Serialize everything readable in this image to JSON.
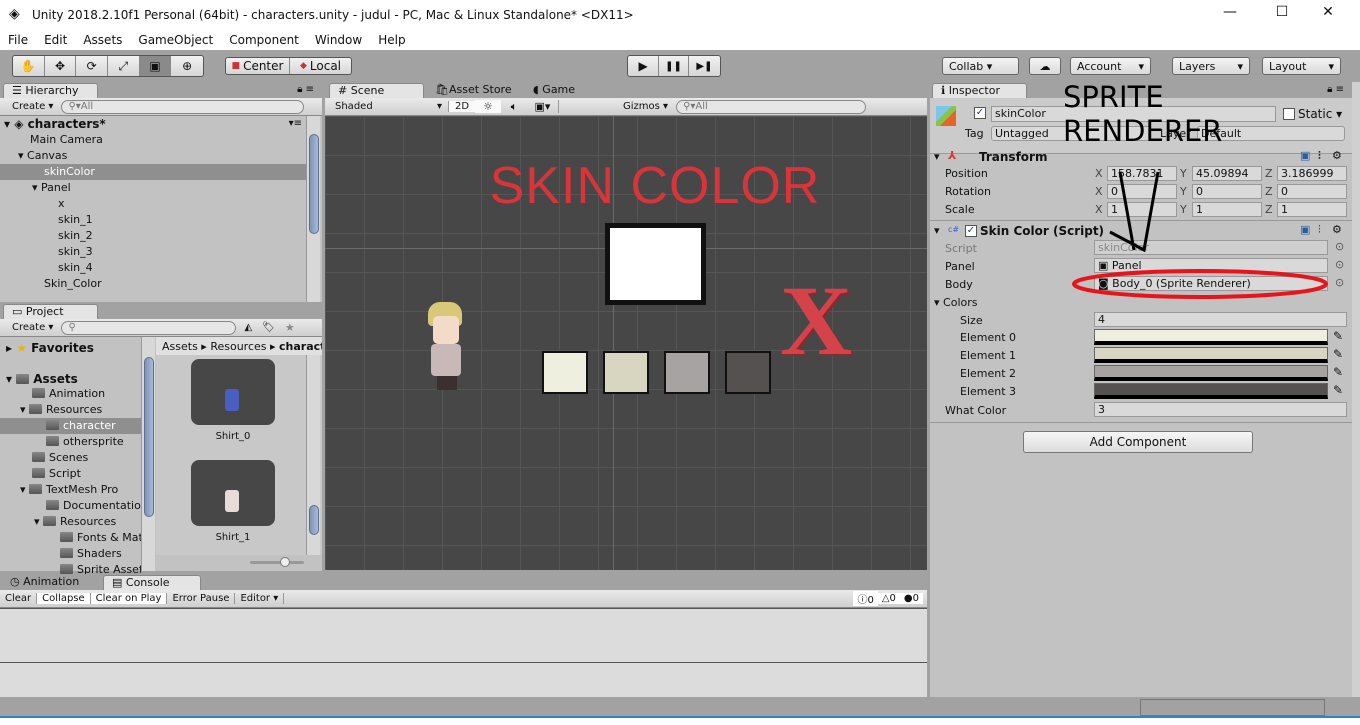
{
  "window": {
    "title": "Unity 2018.2.10f1 Personal (64bit) - characters.unity - judul - PC, Mac & Linux Standalone* <DX11>",
    "minimize": "—",
    "maximize": "☐",
    "close": "✕"
  },
  "menu": [
    "File",
    "Edit",
    "Assets",
    "GameObject",
    "Component",
    "Window",
    "Help"
  ],
  "toolbar": {
    "tools": [
      "hand-tool",
      "move-tool",
      "rotate-tool",
      "scale-tool",
      "rect-tool",
      "transform-tool"
    ],
    "tool_glyphs": [
      "✋",
      "✥",
      "⟳",
      "⤢",
      "▣",
      "⊕"
    ],
    "pivot": "Center",
    "space": "Local",
    "play": "▶",
    "pause": "❚❚",
    "step": "▶❚",
    "collab": "Collab ▾",
    "cloud": "☁",
    "account": "Account",
    "layers": "Layers",
    "layout": "Layout"
  },
  "hierarchy": {
    "tab": "Hierarchy",
    "create": "Create",
    "search_placeholder": "All",
    "scene": "characters*",
    "items": [
      {
        "label": "Main Camera",
        "depth": 1
      },
      {
        "label": "Canvas",
        "depth": 1,
        "expanded": true
      },
      {
        "label": "skinColor",
        "depth": 2,
        "selected": true
      },
      {
        "label": "Panel",
        "depth": 2,
        "expanded": true
      },
      {
        "label": "x",
        "depth": 3
      },
      {
        "label": "skin_1",
        "depth": 3
      },
      {
        "label": "skin_2",
        "depth": 3
      },
      {
        "label": "skin_3",
        "depth": 3
      },
      {
        "label": "skin_4",
        "depth": 3
      },
      {
        "label": "Skin_Color",
        "depth": 2
      }
    ]
  },
  "project": {
    "tab": "Project",
    "create": "Create",
    "favorites": "Favorites",
    "assets": "Assets",
    "tree": [
      {
        "label": "Animation",
        "depth": 1
      },
      {
        "label": "Resources",
        "depth": 1,
        "expanded": true
      },
      {
        "label": "character",
        "depth": 2,
        "selected": true
      },
      {
        "label": "othersprite",
        "depth": 2
      },
      {
        "label": "Scenes",
        "depth": 1
      },
      {
        "label": "Script",
        "depth": 1
      },
      {
        "label": "TextMesh Pro",
        "depth": 1,
        "expanded": true
      },
      {
        "label": "Documentation",
        "depth": 2
      },
      {
        "label": "Resources",
        "depth": 2,
        "expanded": true
      },
      {
        "label": "Fonts & Materials",
        "depth": 3
      },
      {
        "label": "Shaders",
        "depth": 3
      },
      {
        "label": "Sprite Assets",
        "depth": 3
      }
    ],
    "breadcrumb": [
      "Assets",
      "Resources",
      "character"
    ],
    "files": [
      {
        "name": "Shirt_0",
        "color": "#4a5fc0"
      },
      {
        "name": "Shirt_1",
        "color": "#e8dcd8"
      }
    ]
  },
  "scene": {
    "tabs": [
      "Scene",
      "Asset Store",
      "Game"
    ],
    "shading": "Shaded",
    "mode2d": "2D",
    "gizmos": "Gizmos",
    "search_placeholder": "All",
    "title_text": "SKIN COLOR",
    "close_mark": "X",
    "swatches": [
      "#efefe0",
      "#d8d6c0",
      "#a8a3a3",
      "#555151"
    ]
  },
  "inspector": {
    "tab": "Inspector",
    "object_name": "skinColor",
    "static": "Static",
    "tag_label": "Tag",
    "tag": "Untagged",
    "layer_label": "Layer",
    "layer": "Default",
    "transform": {
      "title": "Transform",
      "rows": [
        {
          "label": "Position",
          "x": "158.7831",
          "y": "45.09894",
          "z": "3.186999"
        },
        {
          "label": "Rotation",
          "x": "0",
          "y": "0",
          "z": "0"
        },
        {
          "label": "Scale",
          "x": "1",
          "y": "1",
          "z": "1"
        }
      ]
    },
    "script_component": {
      "title": "Skin Color (Script)",
      "script_label": "Script",
      "script": "skinColor",
      "panel_label": "Panel",
      "panel": "Panel",
      "body_label": "Body",
      "body": "Body_0 (Sprite Renderer)",
      "colors_label": "Colors",
      "size_label": "Size",
      "size": "4",
      "elements": [
        {
          "label": "Element 0",
          "color": "#efefe0"
        },
        {
          "label": "Element 1",
          "color": "#d8d6c0"
        },
        {
          "label": "Element 2",
          "color": "#a8a3a3"
        },
        {
          "label": "Element 3",
          "color": "#555151"
        }
      ],
      "what_color_label": "What Color",
      "what_color": "3"
    },
    "add_component": "Add Component"
  },
  "annotation": {
    "line1": "SPRITE",
    "line2": "RENDERER",
    "ellipse_color": "#e8141c"
  },
  "console": {
    "tabs": [
      "Animation",
      "Console"
    ],
    "buttons": [
      "Clear",
      "Collapse",
      "Clear on Play",
      "Error Pause",
      "Editor"
    ],
    "counts": {
      "info": "0",
      "warn": "0",
      "error": "0"
    }
  }
}
